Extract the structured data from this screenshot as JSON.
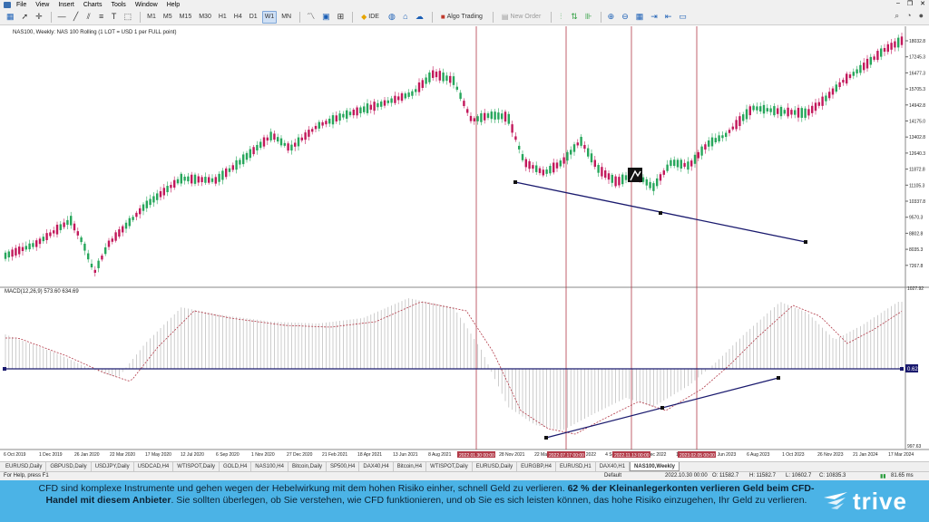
{
  "menu": [
    "File",
    "View",
    "Insert",
    "Charts",
    "Tools",
    "Window",
    "Help"
  ],
  "toolbar": {
    "timeframes": [
      "M1",
      "M5",
      "M15",
      "M30",
      "H1",
      "H4",
      "D1",
      "W1",
      "MN"
    ],
    "active_timeframe": "W1",
    "ide_label": "IDE",
    "algo_trading_label": "Algo Trading",
    "new_order_label": "New Order"
  },
  "chart": {
    "header": "NAS100, Weekly:  NAS 100 Rolling (1 LOT = USD 1 per FULL point)",
    "macd_label": "MACD(12,26,9) 573.60 634.69",
    "price_ticks": [
      "18032.8",
      "17245.3",
      "16477.3",
      "15705.3",
      "14942.8",
      "14175.0",
      "13402.8",
      "12640.3",
      "11872.8",
      "11105.3",
      "10337.8",
      "9570.3",
      "8802.8",
      "8035.3",
      "7267.8"
    ],
    "macd_ticks": [
      "1027.92",
      "0.00",
      "997.63"
    ],
    "macd_zero_badge": "0.62",
    "date_ticks": [
      "6 Oct 2019",
      "1 Dec 2019",
      "26 Jan 2020",
      "22 Mar 2020",
      "17 May 2020",
      "12 Jul 2020",
      "6 Sep 2020",
      "1 Nov 2020",
      "27 Dec 2020",
      "21 Feb 2021",
      "18 Apr 2021",
      "13 Jun 2021",
      "8 Aug 2021",
      "3 Oct 2021",
      "28 Nov 2021",
      "22 Mar 2022",
      "15 May 2022",
      "4 Sep 2022",
      "25 Dec 2022",
      "16 Apr 2023",
      "11 Jun 2023",
      "6 Aug 2023",
      "1 Oct 2023",
      "26 Nov 2023",
      "21 Jan 2024",
      "17 Mar 2024"
    ],
    "marker_labels": [
      "2022.01.30 00:00",
      "2022.07.17 00:00",
      "2022.11.13 00:00",
      "2023.02.05 00:00"
    ],
    "colors": {
      "bull": "#26a65b",
      "bear": "#c2185b",
      "trendline": "#1a1a6e",
      "vline": "#b23a48",
      "macd_signal": "#b23a48",
      "macd_hist": "#b8b8b8"
    }
  },
  "tabs": [
    "EURUSD,Daily",
    "GBPUSD,Daily",
    "USDJPY,Daily",
    "USDCAD,H4",
    "WTISPOT,Daily",
    "GOLD,H4",
    "NAS100,H4",
    "Bitcoin,Daily",
    "SP500,H4",
    "DAX40,H4",
    "Bitcoin,H4",
    "WTISPOT,Daily",
    "EURUSD,Daily",
    "EURGBP,H4",
    "EURUSD,H1",
    "DAX40,H1",
    "NAS100,Weekly"
  ],
  "active_tab": "NAS100,Weekly",
  "status": {
    "help": "For Help, press F1",
    "profile": "Default",
    "time": "2022.10.30 00:00",
    "open": "O: 11582.7",
    "high": "H: 11582.7",
    "low": "L: 10602.7",
    "close": "C: 10835.3",
    "traffic": "81.65 ms"
  },
  "disclaimer": {
    "part1": "CFD sind komplexe Instrumente und gehen wegen der Hebelwirkung mit dem hohen Risiko einher, schnell Geld zu verlieren. ",
    "bold": "62 % der Kleinanlegerkonten verlieren Geld beim CFD-Handel mit diesem Anbieter",
    "part2": ". Sie sollten überlegen, ob Sie verstehen, wie CFD funktionieren, und ob Sie es sich leisten können, das hohe Risiko einzugehen, Ihr Geld zu verlieren."
  },
  "brand": "trive"
}
